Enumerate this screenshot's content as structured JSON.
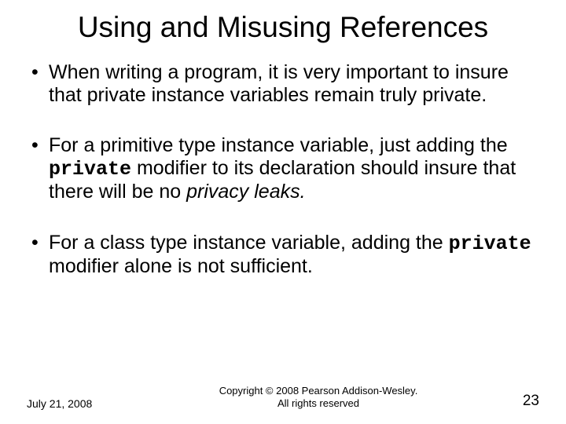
{
  "title": "Using and Misusing References",
  "bullets": [
    {
      "pre": "When writing a program, it is very important to insure that private instance variables remain truly private.",
      "mono": "",
      "post": "",
      "italic": ""
    },
    {
      "pre": "For a primitive type instance variable, just adding the ",
      "mono": "private",
      "post": " modifier to its declaration should insure that there will be no ",
      "italic": "privacy leaks."
    },
    {
      "pre": "For a class type instance variable, adding the ",
      "mono": "private",
      "post": " modifier alone is not sufficient.",
      "italic": ""
    }
  ],
  "footer": {
    "date": "July 21, 2008",
    "copyright_line1": "Copyright © 2008 Pearson Addison-Wesley.",
    "copyright_line2": "All rights reserved",
    "page": "23"
  }
}
